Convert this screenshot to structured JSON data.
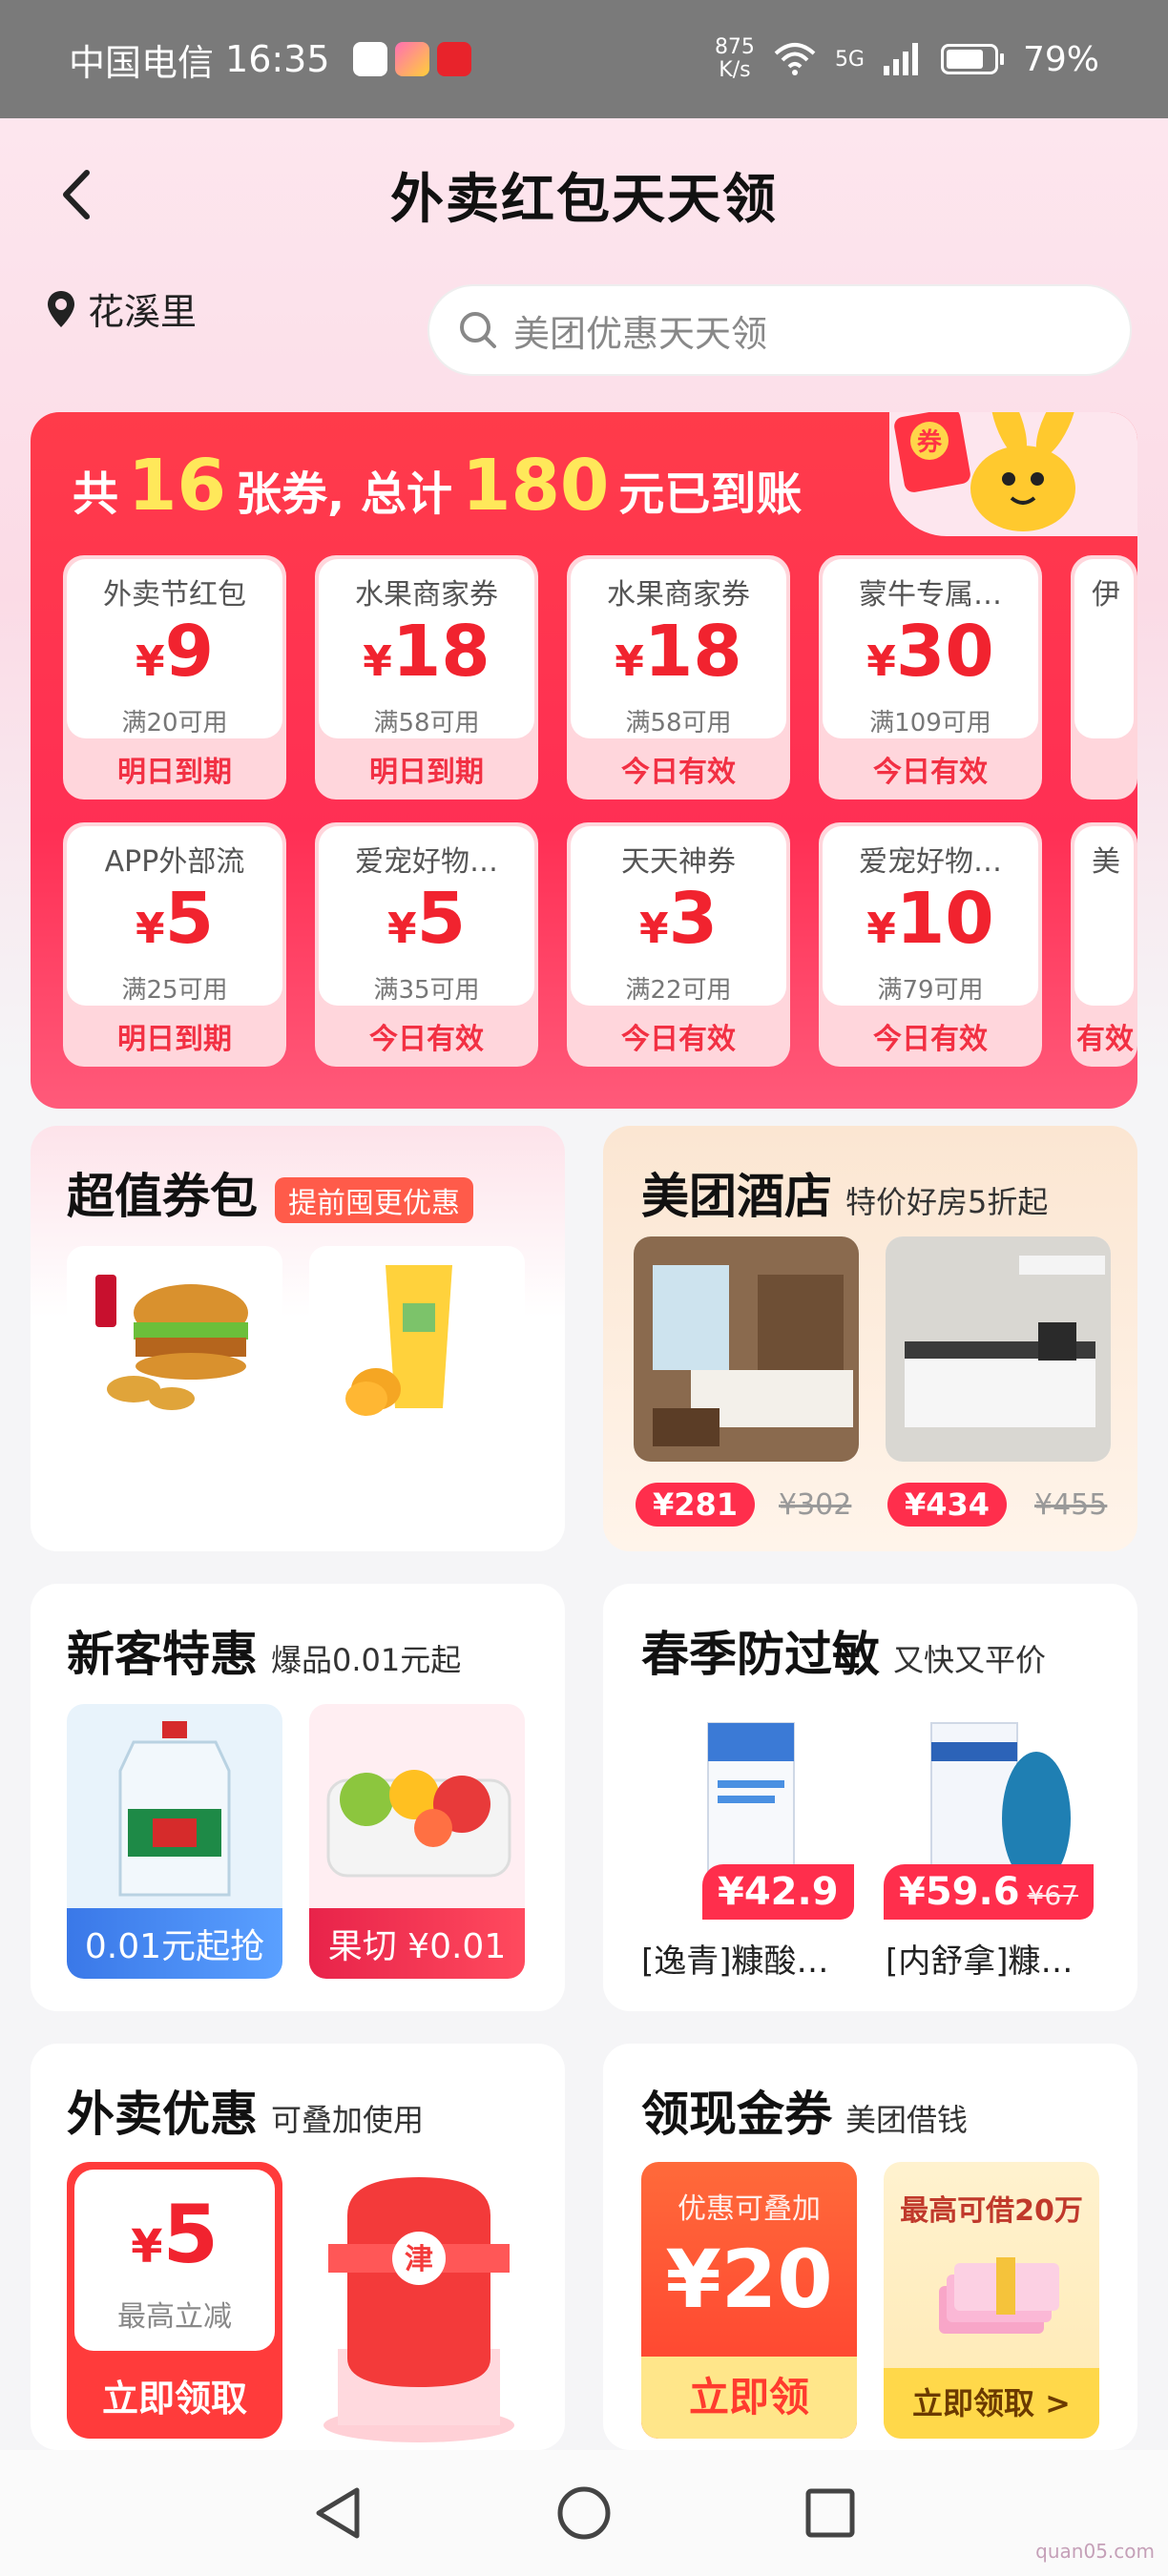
{
  "status_bar": {
    "carrier": "中国电信",
    "time": "16:35",
    "net_speed_value": "875",
    "net_speed_unit": "K/s",
    "network": "5G",
    "battery": "79%",
    "battery_level": 0.79
  },
  "header": {
    "title": "外卖红包天天领"
  },
  "location": {
    "name": "花溪里"
  },
  "search": {
    "placeholder": "美团优惠天天领"
  },
  "coupon_summary": {
    "prefix": "共",
    "count": "16",
    "middle": "张券, 总计",
    "total": "180",
    "suffix": "元已到账",
    "mascot_label": "券"
  },
  "coupons_row1": [
    {
      "name": "外卖节红包",
      "amount": "9",
      "condition": "满20可用",
      "expire": "明日到期"
    },
    {
      "name": "水果商家券",
      "amount": "18",
      "condition": "满58可用",
      "expire": "明日到期"
    },
    {
      "name": "水果商家券",
      "amount": "18",
      "condition": "满58可用",
      "expire": "今日有效"
    },
    {
      "name": "蒙牛专属…",
      "amount": "30",
      "condition": "满109可用",
      "expire": "今日有效"
    },
    {
      "name": "伊",
      "amount": "",
      "condition": "",
      "expire": ""
    }
  ],
  "coupons_row2": [
    {
      "name": "APP外部流",
      "amount": "5",
      "condition": "满25可用",
      "expire": "明日到期"
    },
    {
      "name": "爱宠好物…",
      "amount": "5",
      "condition": "满35可用",
      "expire": "今日有效"
    },
    {
      "name": "天天神券",
      "amount": "3",
      "condition": "满22可用",
      "expire": "今日有效"
    },
    {
      "name": "爱宠好物…",
      "amount": "10",
      "condition": "满79可用",
      "expire": "今日有效"
    },
    {
      "name": "美",
      "amount": "",
      "condition": "",
      "expire": "有效"
    }
  ],
  "currency": "¥",
  "value_pack": {
    "title": "超值券包",
    "tag": "提前囤更优惠"
  },
  "hotel": {
    "title": "美团酒店",
    "subtitle": "特价好房5折起",
    "items": [
      {
        "price": "¥281",
        "old_price": "¥302"
      },
      {
        "price": "¥434",
        "old_price": "¥455"
      }
    ]
  },
  "new_customer": {
    "title": "新客特惠",
    "subtitle": "爆品0.01元起",
    "items": [
      {
        "label": "0.01元起抢"
      },
      {
        "label": "果切 ¥0.01"
      }
    ]
  },
  "allergy": {
    "title": "春季防过敏",
    "subtitle": "又快又平价",
    "items": [
      {
        "price": "¥42.9",
        "old_price": "",
        "name": "[逸青]糠酸…"
      },
      {
        "price": "¥59.6",
        "old_price": "¥67",
        "name": "[内舒拿]糠…"
      }
    ]
  },
  "takeout_deal": {
    "title": "外卖优惠",
    "subtitle": "可叠加使用",
    "amount": "5",
    "note": "最高立减",
    "button": "立即领取",
    "jar_label": "津"
  },
  "cash_coupon": {
    "title": "领现金券",
    "subtitle": "美团借钱",
    "stack_label": "优惠可叠加",
    "amount": "¥20",
    "button": "立即领",
    "loan_label": "最高可借20万",
    "loan_button": "立即领取 >"
  },
  "watermark": "quan05.com",
  "colors": {
    "accent": "#ff2e4c",
    "coupon_red": "#f1232f",
    "highlight_yellow": "#ffe85a"
  }
}
